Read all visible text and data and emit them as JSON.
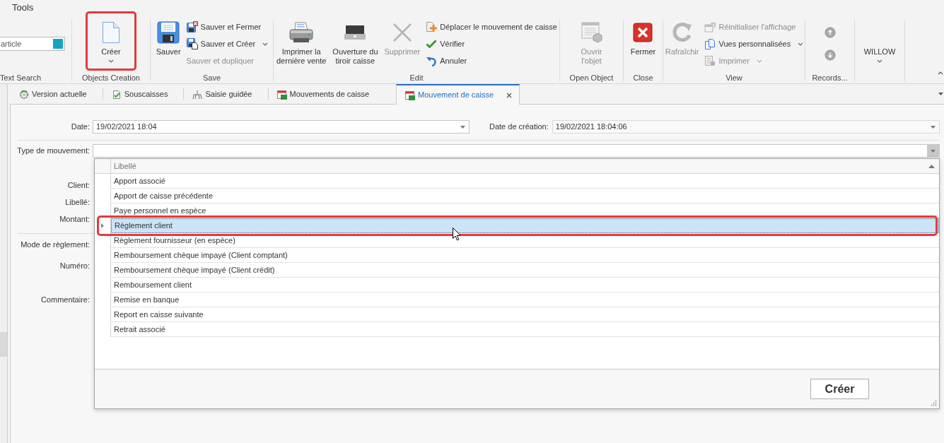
{
  "ribbon": {
    "tab": "Tools",
    "groups": [
      {
        "label": "Text Search",
        "items": [
          {
            "kind": "search",
            "placeholder": "article"
          }
        ]
      },
      {
        "label": "Objects Creation",
        "items": [
          {
            "kind": "large",
            "lines": [
              "Créer"
            ],
            "disabled": false,
            "menu": true,
            "highlighted": true
          }
        ]
      },
      {
        "label": "Save",
        "items": [
          {
            "kind": "large",
            "lines": [
              "Sauver"
            ],
            "disabled": false,
            "menu": false,
            "highlighted": false
          },
          {
            "kind": "stack",
            "items": [
              {
                "label": "Sauver et Fermer",
                "disabled": false,
                "menu": false
              },
              {
                "label": "Sauver et Créer",
                "disabled": false,
                "menu": true
              },
              {
                "label": "Sauver et dupliquer",
                "disabled": true,
                "menu": false
              }
            ]
          }
        ]
      },
      {
        "label": "Edit",
        "items": [
          {
            "kind": "large",
            "lines": [
              "Imprimer la",
              "dernière vente"
            ],
            "disabled": false,
            "menu": false,
            "highlighted": false
          },
          {
            "kind": "large",
            "lines": [
              "Ouverture du",
              "tiroir caisse"
            ],
            "disabled": false,
            "menu": false,
            "highlighted": false
          },
          {
            "kind": "large",
            "lines": [
              "Supprimer"
            ],
            "disabled": true,
            "menu": false,
            "highlighted": false
          },
          {
            "kind": "stack",
            "items": [
              {
                "label": "Déplacer le mouvement de caisse",
                "disabled": false,
                "menu": false
              },
              {
                "label": "Vérifier",
                "disabled": false,
                "menu": false
              },
              {
                "label": "Annuler",
                "disabled": false,
                "menu": false
              }
            ]
          }
        ]
      },
      {
        "label": "Open Object",
        "items": [
          {
            "kind": "large",
            "lines": [
              "Ouvrir",
              "l'objet"
            ],
            "disabled": true,
            "menu": false,
            "highlighted": false
          }
        ]
      },
      {
        "label": "Close",
        "items": [
          {
            "kind": "large",
            "lines": [
              "Fermer"
            ],
            "disabled": false,
            "menu": false,
            "highlighted": false
          }
        ]
      },
      {
        "label": "View",
        "items": [
          {
            "kind": "large",
            "lines": [
              "Rafraîchir"
            ],
            "disabled": true,
            "menu": false,
            "highlighted": false
          },
          {
            "kind": "stack",
            "items": [
              {
                "label": "Réinitialiser l'affichage",
                "disabled": true,
                "menu": false
              },
              {
                "label": "Vues personnalisées",
                "disabled": false,
                "menu": true
              },
              {
                "label": "Imprimer",
                "disabled": true,
                "menu": true
              }
            ]
          }
        ]
      },
      {
        "label": "Records...",
        "items": [
          {
            "kind": "stepper"
          }
        ]
      },
      {
        "items": [
          {
            "kind": "large",
            "lines": [
              "WILLOW"
            ],
            "disabled": false,
            "menu": true,
            "highlighted": false
          }
        ]
      }
    ]
  },
  "document_tabs": [
    {
      "label": "Version actuelle",
      "selected": false
    },
    {
      "label": "Souscaisses",
      "selected": false
    },
    {
      "label": "Saisie guidée",
      "selected": false
    },
    {
      "label": "Mouvements de caisse",
      "selected": false
    },
    {
      "label": "Mouvement de caisse",
      "selected": true
    }
  ],
  "form": {
    "date": {
      "label": "Date:",
      "value": "19/02/2021 18:04",
      "readonly": false
    },
    "creation_date": {
      "label": "Date de création:",
      "value": "19/02/2021 18:04:06",
      "readonly": true
    },
    "movement_type": {
      "label": "Type de mouvement:",
      "expanded": true,
      "dropdown": {
        "column": "Libellé",
        "sorted": true,
        "rows": [
          {
            "text": "Apport associé",
            "selected": false,
            "highlighted": false
          },
          {
            "text": "Apport de caisse précédente",
            "selected": false,
            "highlighted": false
          },
          {
            "text": "Paye personnel en espèce",
            "selected": false,
            "highlighted": false
          },
          {
            "text": "Règlement client",
            "selected": true,
            "highlighted": true
          },
          {
            "text": "Règlement fournisseur (en espèce)",
            "selected": false,
            "highlighted": false
          },
          {
            "text": "Remboursement chèque impayé (Client comptant)",
            "selected": false,
            "highlighted": false
          },
          {
            "text": "Remboursement chèque impayé (Client crédit)",
            "selected": false,
            "highlighted": false
          },
          {
            "text": "Remboursement client",
            "selected": false,
            "highlighted": false
          },
          {
            "text": "Remise en banque",
            "selected": false,
            "highlighted": false
          },
          {
            "text": "Report en caisse suivante",
            "selected": false,
            "highlighted": false
          },
          {
            "text": "Retrait associé",
            "selected": false,
            "highlighted": false
          }
        ],
        "button": "Créer"
      }
    },
    "sections": [
      [
        "Client:",
        "Libellé:",
        "Montant:"
      ],
      [
        "Mode de règlement:",
        "Numéro:",
        "Commentaire:"
      ]
    ]
  }
}
